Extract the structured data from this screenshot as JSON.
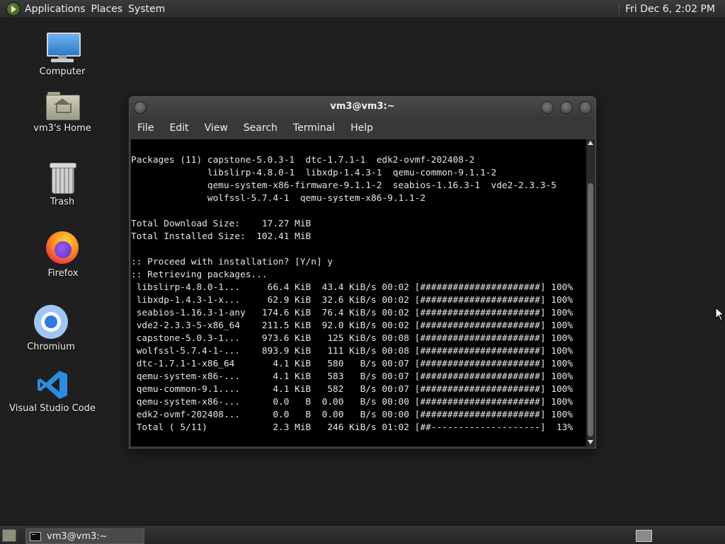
{
  "top_panel": {
    "menus": [
      "Applications",
      "Places",
      "System"
    ],
    "clock": "Fri Dec 6,  2:02 PM"
  },
  "desktop_icons": {
    "computer": "Computer",
    "home": "vm3's Home",
    "trash": "Trash",
    "firefox": "Firefox",
    "chromium": "Chromium",
    "vscode": "Visual Studio Code"
  },
  "terminal_window": {
    "title": "vm3@vm3:~",
    "menu": [
      "File",
      "Edit",
      "View",
      "Search",
      "Terminal",
      "Help"
    ],
    "output": "Packages (11) capstone-5.0.3-1  dtc-1.7.1-1  edk2-ovmf-202408-2\n              libslirp-4.8.0-1  libxdp-1.4.3-1  qemu-common-9.1.1-2\n              qemu-system-x86-firmware-9.1.1-2  seabios-1.16.3-1  vde2-2.3.3-5\n              wolfssl-5.7.4-1  qemu-system-x86-9.1.1-2\n\nTotal Download Size:    17.27 MiB\nTotal Installed Size:  102.41 MiB\n\n:: Proceed with installation? [Y/n] y\n:: Retrieving packages...\n libslirp-4.8.0-1...     66.4 KiB  43.4 KiB/s 00:02 [######################] 100%\n libxdp-1.4.3-1-x...     62.9 KiB  32.6 KiB/s 00:02 [######################] 100%\n seabios-1.16.3-1-any   174.6 KiB  76.4 KiB/s 00:02 [######################] 100%\n vde2-2.3.3-5-x86_64    211.5 KiB  92.0 KiB/s 00:02 [######################] 100%\n capstone-5.0.3-1...    973.6 KiB   125 KiB/s 00:08 [######################] 100%\n wolfssl-5.7.4-1-...    893.9 KiB   111 KiB/s 00:08 [######################] 100%\n dtc-1.7.1-1-x86_64       4.1 KiB   580   B/s 00:07 [######################] 100%\n qemu-system-x86-...      4.1 KiB   583   B/s 00:07 [######################] 100%\n qemu-common-9.1....      4.1 KiB   582   B/s 00:07 [######################] 100%\n qemu-system-x86-...      0.0   B  0.00   B/s 00:00 [######################] 100%\n edk2-ovmf-202408...      0.0   B  0.00   B/s 00:00 [######################] 100%\n Total ( 5/11)            2.3 MiB   246 KiB/s 01:02 [##--------------------]  13%"
  },
  "taskbar": {
    "items": [
      "vm3@vm3:~"
    ]
  },
  "colors": {
    "desktop_bg": "#1f1f1f",
    "terminal_bg": "#000000",
    "terminal_fg": "#e6e6e6",
    "panel_bg": "#2b2b2b"
  }
}
